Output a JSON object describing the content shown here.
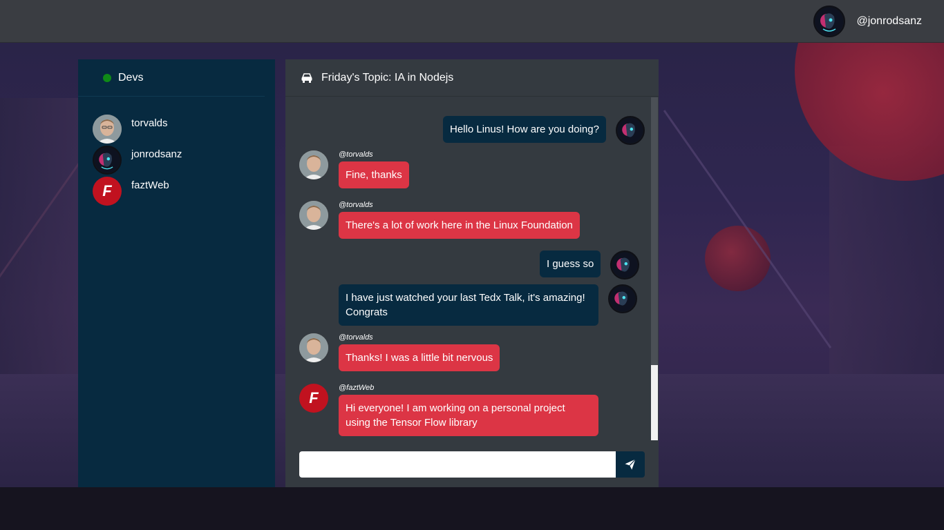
{
  "topbar": {
    "username": "@jonrodsanz",
    "avatar_icon": "cyberpunk-avatar"
  },
  "sidebar": {
    "room_name": "Devs",
    "status_color": "#0f8a17",
    "users": [
      {
        "name": "torvalds",
        "avatar": "torvalds"
      },
      {
        "name": "jonrodsanz",
        "avatar": "cyber"
      },
      {
        "name": "faztWeb",
        "avatar": "fazt",
        "avatar_letter": "F"
      }
    ]
  },
  "chat": {
    "topic": "Friday's Topic: IA in Nodejs",
    "topic_icon": "car-icon",
    "messages": [
      {
        "from": "me",
        "text": "Hello Linus! How are you doing?"
      },
      {
        "from": "torvalds",
        "handle": "@torvalds",
        "text": "Fine, thanks"
      },
      {
        "from": "torvalds",
        "handle": "@torvalds",
        "text": "There's a lot of work here in the Linux Foundation"
      },
      {
        "from": "me",
        "text": "I guess so"
      },
      {
        "from": "me",
        "text": "I have just watched your last Tedx Talk, it's amazing! Congrats"
      },
      {
        "from": "torvalds",
        "handle": "@torvalds",
        "text": "Thanks! I was a little bit nervous"
      },
      {
        "from": "faztWeb",
        "handle": "@faztWeb",
        "avatar_letter": "F",
        "text": "Hi everyone! I am working on a personal project using the Tensor Flow library"
      }
    ],
    "composer": {
      "placeholder": "",
      "value": "",
      "send_icon": "paper-plane-icon"
    }
  },
  "colors": {
    "me_bubble": "#072a40",
    "other_bubble": "#dc3545",
    "panel": "#343a40",
    "sidebar": "#072a40"
  }
}
